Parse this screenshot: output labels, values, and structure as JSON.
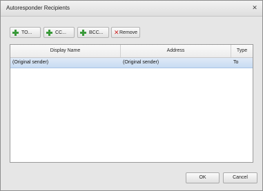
{
  "window": {
    "title": "Autoresponder Recipients"
  },
  "toolbar": {
    "to_label": "TO...",
    "cc_label": "CC...",
    "bcc_label": "BCC...",
    "remove_label": "Remove"
  },
  "grid": {
    "columns": [
      "Display Name",
      "Address",
      "Type"
    ],
    "rows": [
      {
        "display_name": "(Original sender)",
        "address": "(Original sender)",
        "type": "To"
      }
    ]
  },
  "footer": {
    "ok_label": "OK",
    "cancel_label": "Cancel"
  },
  "colors": {
    "selection": "#c8dcf2",
    "add_icon": "#3a9a3a",
    "remove_icon": "#cc2020"
  }
}
